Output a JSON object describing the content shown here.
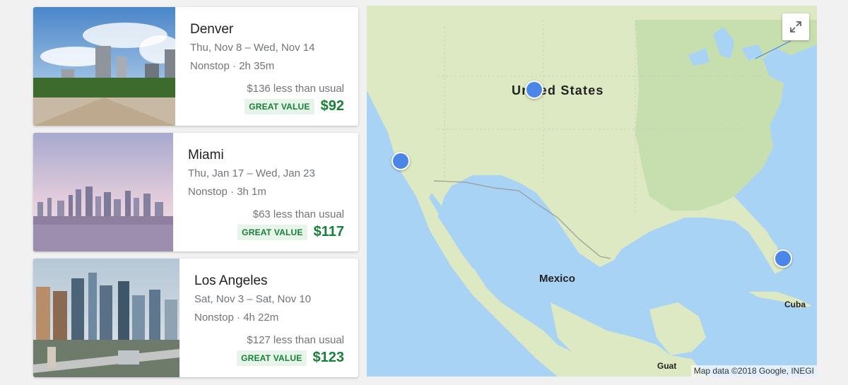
{
  "results": [
    {
      "city": "Denver",
      "dates": "Thu, Nov 8 – Wed, Nov 14",
      "stops": "Nonstop · 2h 35m",
      "savings": "$136 less than usual",
      "badge": "GREAT VALUE",
      "price": "$92",
      "image_icon": "denver-city-photo"
    },
    {
      "city": "Miami",
      "dates": "Thu, Jan 17 – Wed, Jan 23",
      "stops": "Nonstop · 3h 1m",
      "savings": "$63 less than usual",
      "badge": "GREAT VALUE",
      "price": "$117",
      "image_icon": "miami-skyline-photo"
    },
    {
      "city": "Los Angeles",
      "dates": "Sat, Nov 3 – Sat, Nov 10",
      "stops": "Nonstop · 4h 22m",
      "savings": "$127 less than usual",
      "badge": "GREAT VALUE",
      "price": "$123",
      "image_icon": "los-angeles-city-photo"
    }
  ],
  "map": {
    "labels": {
      "country": "United States",
      "mexico": "Mexico",
      "cuba": "Cuba",
      "guatemala": "Guat"
    },
    "attribution": "Map data ©2018 Google, INEGI",
    "expand_icon": "fullscreen-expand-icon",
    "pin_icon": "destination-pin",
    "colors": {
      "water": "#a9d3f5",
      "land": "#dde9c2",
      "price_green": "#188038",
      "pin_blue": "#4a86e8"
    }
  }
}
